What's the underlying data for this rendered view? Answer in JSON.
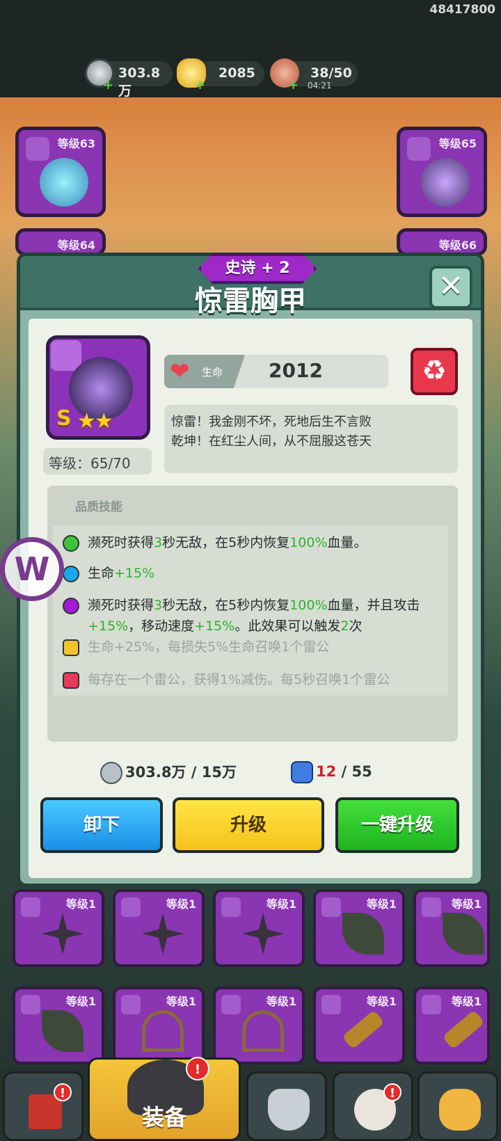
{
  "top": {
    "uid": "48417800",
    "resources": [
      {
        "icon": "silver-coin-icon",
        "value": "303.8万"
      },
      {
        "icon": "gold-ingot-icon",
        "value": "2085"
      },
      {
        "icon": "meat-stamina-icon",
        "value": "38/50"
      }
    ],
    "timer": "04:21"
  },
  "background_slots": [
    {
      "level": "等级63"
    },
    {
      "level": "等级65"
    },
    {
      "level": "等级64"
    },
    {
      "level": "等级66"
    }
  ],
  "dialog": {
    "rarity": "史诗 + 2",
    "title": "惊雷胸甲",
    "close_icon": "close-icon",
    "item": {
      "grade": "S",
      "stars": "★★",
      "level": "等级：65/70"
    },
    "stat": {
      "label": "生命",
      "value": "2012"
    },
    "description": [
      "惊雷！我金刚不坏，死地后生不言败",
      "乾坤！在红尘人间，从不屈服这苍天"
    ],
    "skills_title": "品质技能",
    "skills": [
      {
        "color": "#3ec43a",
        "parts": [
          "濒死时获得",
          "3",
          "秒无敌，在5秒内恢复",
          "100%",
          "血量。"
        ],
        "locked": false
      },
      {
        "color": "#1aa6e8",
        "parts": [
          "生命",
          "+15%"
        ],
        "locked": false
      },
      {
        "color": "#a21ad6",
        "parts": [
          "濒死时获得",
          "3",
          "秒无敌，在5秒内恢复",
          "100%",
          "血量，并且攻击",
          "+15%",
          "，移动速度",
          "+15%",
          "。此效果可以触发",
          "2",
          "次"
        ],
        "locked": false
      },
      {
        "color": "#f2c230",
        "text": "生命+25%，每损失5%生命召唤1个雷公",
        "locked": true
      },
      {
        "color": "#e8395a",
        "text": "每存在一个雷公，获得1%减伤。每5秒召唤1个雷公",
        "locked": true
      }
    ],
    "cost_coin": "303.8万 / 15万",
    "cost_gem_have": "12",
    "cost_gem_need": " / 55",
    "buttons": {
      "unequip": "卸下",
      "upgrade": "升级",
      "upgrade_all": "一键升级"
    }
  },
  "grid_levels": [
    "等级1",
    "等级1",
    "等级1",
    "等级1",
    "等级1",
    "等级1",
    "等级1",
    "等级1",
    "等级1",
    "等级1"
  ],
  "nav": {
    "equip": "装备",
    "badge": "!"
  }
}
